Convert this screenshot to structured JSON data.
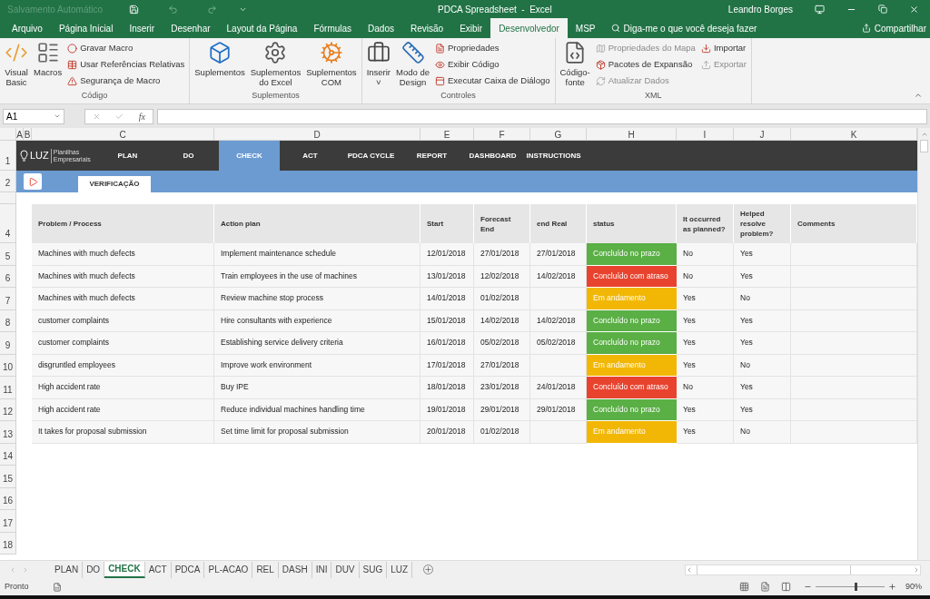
{
  "title_bar": {
    "autosave": "Salvamento Automático",
    "title": "PDCA Spreadsheet  -  Excel",
    "user": "Leandro Borges"
  },
  "ribbon_tabs": [
    {
      "label": "Arquivo",
      "selected": false
    },
    {
      "label": "Página Inicial",
      "selected": false
    },
    {
      "label": "Inserir",
      "selected": false
    },
    {
      "label": "Desenhar",
      "selected": false
    },
    {
      "label": "Layout da Página",
      "selected": false
    },
    {
      "label": "Fórmulas",
      "selected": false
    },
    {
      "label": "Dados",
      "selected": false
    },
    {
      "label": "Revisão",
      "selected": false
    },
    {
      "label": "Exibir",
      "selected": false
    },
    {
      "label": "Desenvolvedor",
      "selected": true
    },
    {
      "label": "MSP",
      "selected": false
    }
  ],
  "tell_me": "Diga-me o que você deseja fazer",
  "share": "Compartilhar",
  "ribbon_groups": [
    {
      "label": "Código",
      "columns": [
        {
          "kind": "large",
          "items": [
            {
              "label": "Visual\nBasic",
              "disabled": false
            },
            {
              "label": "Macros",
              "disabled": false
            }
          ]
        },
        {
          "kind": "stack",
          "items": [
            {
              "label": "Gravar Macro",
              "disabled": false
            },
            {
              "label": "Usar Referências Relativas",
              "disabled": false
            },
            {
              "label": "Segurança de Macro",
              "disabled": false
            }
          ]
        }
      ]
    },
    {
      "label": "Suplementos",
      "columns": [
        {
          "kind": "large",
          "items": [
            {
              "label": "Suplementos",
              "disabled": false
            },
            {
              "label": "Suplementos\ndo Excel",
              "disabled": false
            },
            {
              "label": "Suplementos\nCOM",
              "disabled": false
            }
          ]
        }
      ]
    },
    {
      "label": "Controles",
      "columns": [
        {
          "kind": "large",
          "items": [
            {
              "label": "Inserir\n˅",
              "disabled": false
            },
            {
              "label": "Modo de\nDesign",
              "disabled": false
            }
          ]
        },
        {
          "kind": "stack",
          "items": [
            {
              "label": "Propriedades",
              "disabled": false
            },
            {
              "label": "Exibir Código",
              "disabled": false
            },
            {
              "label": "Executar Caixa de Diálogo",
              "disabled": false
            }
          ]
        }
      ]
    },
    {
      "label": "XML",
      "columns": [
        {
          "kind": "large",
          "items": [
            {
              "label": "Código-\nfonte",
              "disabled": false
            }
          ]
        },
        {
          "kind": "stack",
          "items": [
            {
              "label": "Propriedades do Mapa",
              "disabled": true
            },
            {
              "label": "Pacotes de Expansão",
              "disabled": false
            },
            {
              "label": "Atualizar Dados",
              "disabled": true
            }
          ]
        },
        {
          "kind": "stack",
          "items": [
            {
              "label": "Importar",
              "disabled": false
            },
            {
              "label": "Exportar",
              "disabled": true
            }
          ]
        }
      ]
    }
  ],
  "formula_bar": {
    "name_box": "A1",
    "function_label": "fx"
  },
  "column_headers": [
    "A",
    "B",
    "C",
    "D",
    "E",
    "F",
    "G",
    "H",
    "I",
    "J",
    "K"
  ],
  "nav_row": {
    "row": "1",
    "logo": "LUZ",
    "logo_tagline": "Planilhas Empresariais",
    "items": [
      {
        "label": "PLAN",
        "selected": false
      },
      {
        "label": "DO",
        "selected": false
      },
      {
        "label": "CHECK",
        "selected": true
      },
      {
        "label": "ACT",
        "selected": false
      },
      {
        "label": "PDCA CYCLE",
        "selected": false
      },
      {
        "label": "REPORT",
        "selected": false
      },
      {
        "label": "DASHBOARD",
        "selected": false
      },
      {
        "label": "INSTRUCTIONS",
        "selected": false
      }
    ]
  },
  "sub_row": {
    "row": "2",
    "tab": "VERIFICAÇÃO"
  },
  "table": {
    "row": "4",
    "columns": [
      "Problem / Process",
      "Action plan",
      "Start",
      "Forecast End",
      "end Real",
      "status",
      "It occurred as planned?",
      "Helped resolve problem?",
      "Comments"
    ],
    "rows": [
      {
        "row": "5",
        "problem": "Machines with much defects",
        "action": "Implement maintenance schedule",
        "start": "12/01/2018",
        "forecast_end": "27/01/2018",
        "end_real": "27/01/2018",
        "status": {
          "text": "Concluído no prazo",
          "color": "#5aaf45"
        },
        "occurred": "No",
        "helped": "Yes"
      },
      {
        "row": "6",
        "problem": "Machines with much defects",
        "action": "Train employees in the use of machines",
        "start": "13/01/2018",
        "forecast_end": "12/02/2018",
        "end_real": "14/02/2018",
        "status": {
          "text": "Concluído com atraso",
          "color": "#e8432e"
        },
        "occurred": "No",
        "helped": "Yes"
      },
      {
        "row": "7",
        "problem": "Machines with much defects",
        "action": "Review machine stop process",
        "start": "14/01/2018",
        "forecast_end": "01/02/2018",
        "status": {
          "text": "Em andamento",
          "color": "#f2b705"
        },
        "occurred": "Yes",
        "helped": "No"
      },
      {
        "row": "8",
        "problem": "customer complaints",
        "action": "Hire consultants with experience",
        "start": "15/01/2018",
        "forecast_end": "14/02/2018",
        "end_real": "14/02/2018",
        "status": {
          "text": "Concluído no prazo",
          "color": "#5aaf45"
        },
        "occurred": "Yes",
        "helped": "Yes"
      },
      {
        "row": "9",
        "problem": "customer complaints",
        "action": "Establishing service delivery criteria",
        "start": "16/01/2018",
        "forecast_end": "05/02/2018",
        "end_real": "05/02/2018",
        "status": {
          "text": "Concluído no prazo",
          "color": "#5aaf45"
        },
        "occurred": "Yes",
        "helped": "Yes"
      },
      {
        "row": "10",
        "problem": "disgruntled employees",
        "action": "Improve work environment",
        "start": "17/01/2018",
        "forecast_end": "27/01/2018",
        "status": {
          "text": "Em andamento",
          "color": "#f2b705"
        },
        "occurred": "Yes",
        "helped": "No"
      },
      {
        "row": "11",
        "problem": "High accident rate",
        "action": "Buy IPE",
        "start": "18/01/2018",
        "forecast_end": "23/01/2018",
        "end_real": "24/01/2018",
        "status": {
          "text": "Concluído com atraso",
          "color": "#e8432e"
        },
        "occurred": "No",
        "helped": "Yes"
      },
      {
        "row": "12",
        "problem": "High accident rate",
        "action": "Reduce individual machines handling time",
        "start": "19/01/2018",
        "forecast_end": "29/01/2018",
        "end_real": "29/01/2018",
        "status": {
          "text": "Concluído no prazo",
          "color": "#5aaf45"
        },
        "occurred": "Yes",
        "helped": "Yes"
      },
      {
        "row": "13",
        "problem": "It takes for proposal submission",
        "action": "Set time limit for proposal submission",
        "start": "20/01/2018",
        "forecast_end": "01/02/2018",
        "status": {
          "text": "Em andamento",
          "color": "#f2b705"
        },
        "occurred": "Yes",
        "helped": "No"
      }
    ]
  },
  "empty_rows": [
    "14",
    "15",
    "16",
    "17",
    "18"
  ],
  "sheet_tabs": [
    {
      "label": "PLAN",
      "selected": false
    },
    {
      "label": "DO",
      "selected": false
    },
    {
      "label": "CHECK",
      "selected": true
    },
    {
      "label": "ACT",
      "selected": false
    },
    {
      "label": "PDCA",
      "selected": false
    },
    {
      "label": "PL-ACAO",
      "selected": false
    },
    {
      "label": "REL",
      "selected": false
    },
    {
      "label": "DASH",
      "selected": false
    },
    {
      "label": "INI",
      "selected": false
    },
    {
      "label": "DUV",
      "selected": false
    },
    {
      "label": "SUG",
      "selected": false
    },
    {
      "label": "LUZ",
      "selected": false
    }
  ],
  "status_bar": {
    "status": "Pronto",
    "zoom": {
      "level": 0.56,
      "reading": "90%"
    }
  }
}
